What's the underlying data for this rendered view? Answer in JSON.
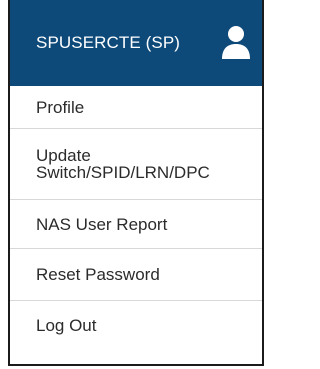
{
  "header": {
    "title": "SPUSERCTE (SP)",
    "icon": "user-icon",
    "background": "#0d4a7a"
  },
  "menu": {
    "items": [
      {
        "label": "Profile"
      },
      {
        "label": "Update\nSwitch/SPID/LRN/DPC"
      },
      {
        "label": "NAS User Report"
      },
      {
        "label": "Reset Password"
      },
      {
        "label": "Log Out"
      }
    ]
  }
}
